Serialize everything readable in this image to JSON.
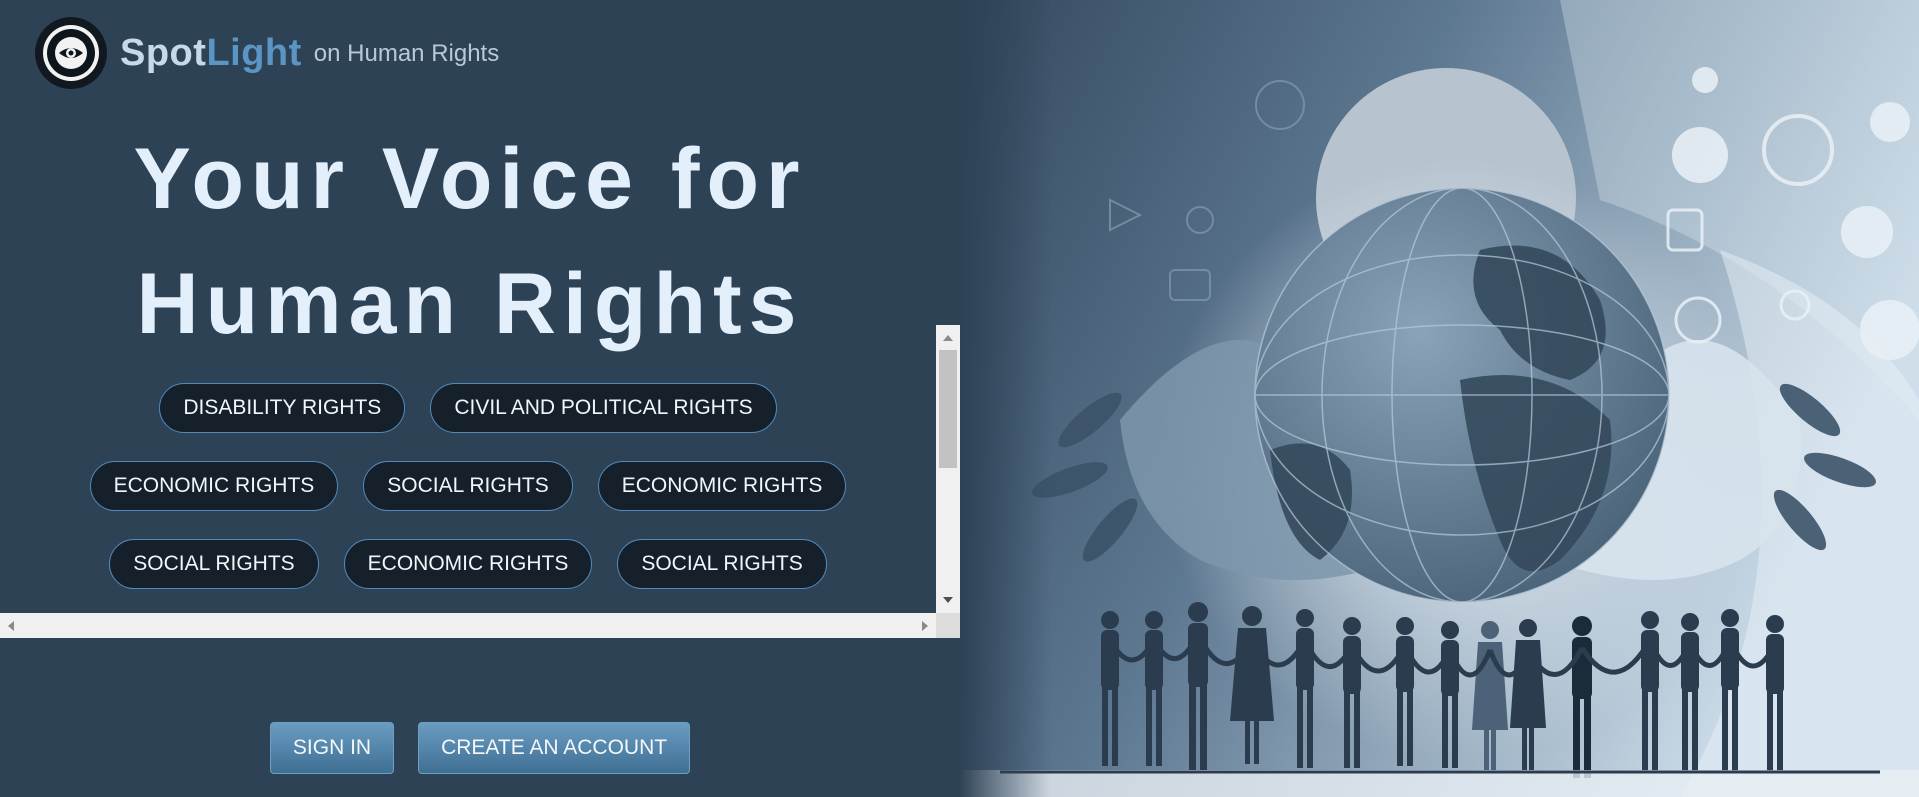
{
  "header": {
    "brand_part1": "Spot",
    "brand_part2": "Light",
    "tagline": "on Human Rights",
    "logo_icon": "eye-seal-logo"
  },
  "hero": {
    "line1": "Your Voice for",
    "line2": "Human Rights"
  },
  "categories": {
    "row1": [
      "DISABILITY RIGHTS",
      "CIVIL AND POLITICAL RIGHTS"
    ],
    "row2": [
      "ECONOMIC RIGHTS",
      "SOCIAL RIGHTS",
      "ECONOMIC RIGHTS"
    ],
    "row3": [
      "SOCIAL RIGHTS",
      "ECONOMIC RIGHTS",
      "SOCIAL RIGHTS"
    ]
  },
  "actions": {
    "sign_in": "SIGN IN",
    "create_account": "CREATE AN ACCOUNT"
  },
  "illustration": {
    "icon": "globe-hands-people-illustration"
  },
  "colors": {
    "background": "#2e4256",
    "accent": "#5b95c4",
    "pill_bg": "#15202b",
    "pill_border": "#4f8bbf",
    "button_top": "#6a9cc2",
    "button_bottom": "#3f6f93"
  }
}
